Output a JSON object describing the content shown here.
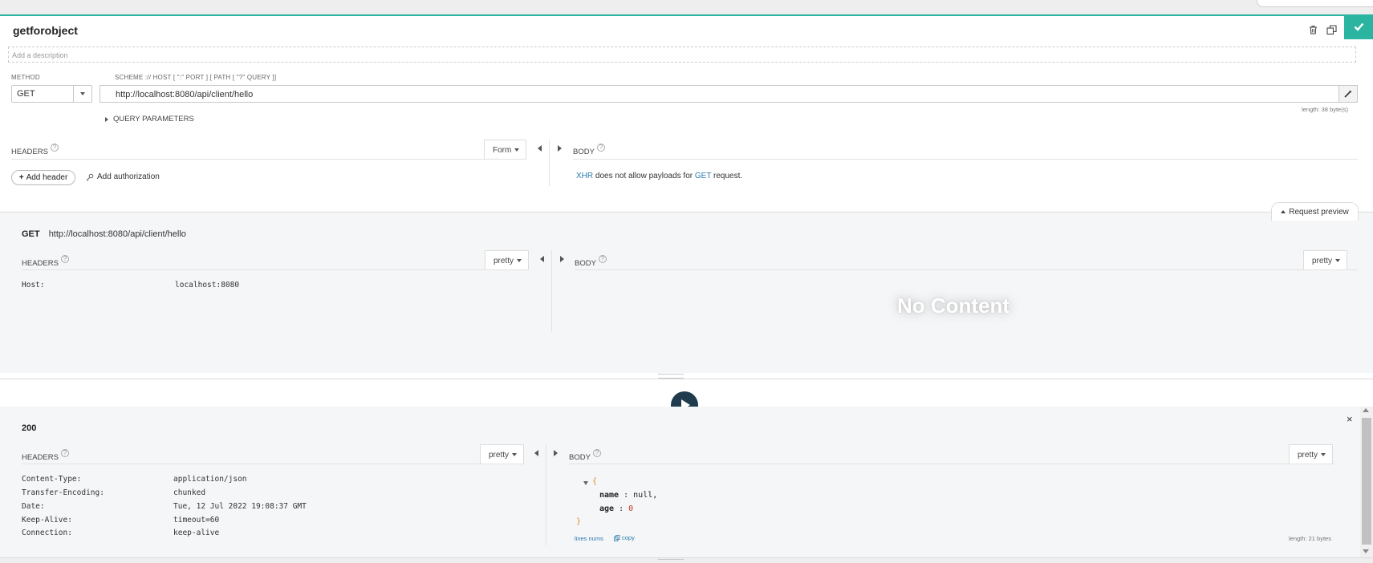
{
  "request": {
    "title": "getforobject",
    "description_placeholder": "Add a description",
    "method_label": "METHOD",
    "method_value": "GET",
    "url_label": "SCHEME :// HOST [ \":\" PORT ] [ PATH [ \"?\" QUERY ]]",
    "url_value": "http://localhost:8080/api/client/hello",
    "length": "length: 38 byte(s)",
    "query_params_label": "QUERY PARAMETERS",
    "headers_label": "HEADERS",
    "headers_mode": "Form",
    "body_label": "BODY",
    "add_header": "Add header",
    "add_authorization": "Add authorization",
    "body_msg_prefix": "XHR",
    "body_msg_mid": " does not allow payloads for ",
    "body_msg_method": "GET",
    "body_msg_suffix": " request."
  },
  "preview": {
    "tab_label": "Request preview",
    "method": "GET",
    "url": "http://localhost:8080/api/client/hello",
    "headers_label": "HEADERS",
    "headers_mode": "pretty",
    "body_label": "BODY",
    "body_mode": "pretty",
    "headers": [
      {
        "name": "Host:",
        "value": "localhost:8080"
      }
    ],
    "no_content": "No Content"
  },
  "response": {
    "status": "200",
    "headers_label": "HEADERS",
    "headers_mode": "pretty",
    "body_label": "BODY",
    "body_mode": "pretty",
    "headers": [
      {
        "name": "Content-Type:",
        "value": "application/json"
      },
      {
        "name": "Transfer-Encoding:",
        "value": "chunked"
      },
      {
        "name": "Date:",
        "value": "Tue, 12 Jul 2022 19:08:37 GMT"
      },
      {
        "name": "Keep-Alive:",
        "value": "timeout=60"
      },
      {
        "name": "Connection:",
        "value": "keep-alive"
      }
    ],
    "json_open": "{",
    "json_close": "}",
    "json_fields": [
      {
        "key": "name",
        "value": "null,"
      },
      {
        "key": "age",
        "value": "0"
      }
    ],
    "lines_nums": "lines nums",
    "copy": "copy",
    "length": "length: 21 bytes"
  },
  "colors": {
    "accent": "#2bb5a0",
    "play": "#1f3b4d",
    "link": "#2a7ab0"
  }
}
